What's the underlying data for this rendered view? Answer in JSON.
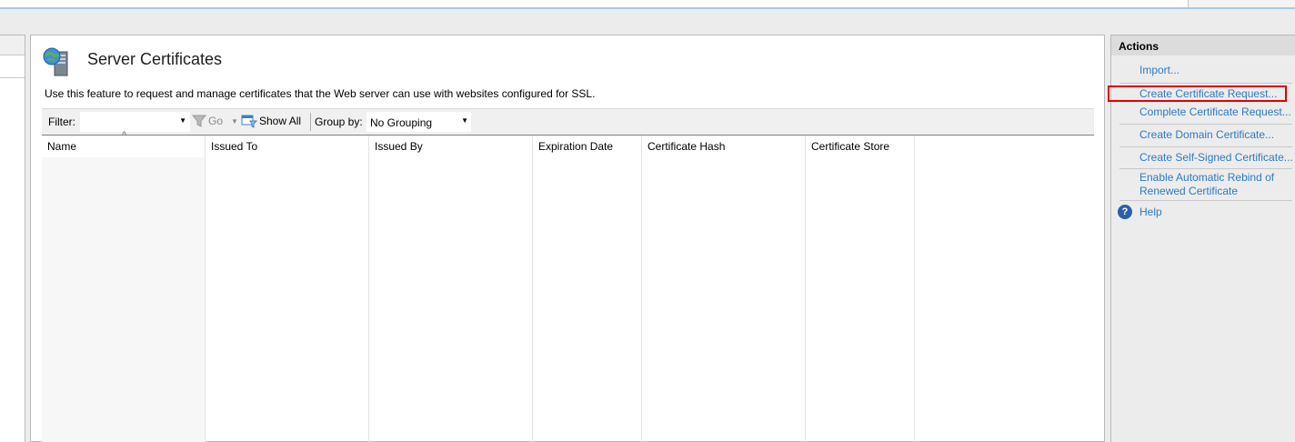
{
  "page": {
    "title": "Server Certificates",
    "description": "Use this feature to request and manage certificates that the Web server can use with websites configured for SSL."
  },
  "filterbar": {
    "filter_label": "Filter:",
    "filter_value": "",
    "go_label": "Go",
    "show_all_label": "Show All",
    "group_by_label": "Group by:",
    "group_by_value": "No Grouping"
  },
  "table": {
    "columns": [
      "Name",
      "Issued To",
      "Issued By",
      "Expiration Date",
      "Certificate Hash",
      "Certificate Store"
    ],
    "sorted_column": "Name",
    "rows": []
  },
  "actions": {
    "title": "Actions",
    "items": [
      {
        "label": "Import..."
      },
      {
        "label": "Create Certificate Request..."
      },
      {
        "label": "Complete Certificate Request..."
      },
      {
        "label": "Create Domain Certificate..."
      },
      {
        "label": "Create Self-Signed Certificate..."
      },
      {
        "label": "Enable Automatic Rebind of"
      },
      {
        "label": "Renewed Certificate"
      },
      {
        "label": "Help"
      }
    ],
    "highlighted": "Create Certificate Request..."
  },
  "colors": {
    "link": "#2d7ac2",
    "highlight_box": "#e00000",
    "panel_bg": "#ececec"
  },
  "icons": {
    "feature": "server-certificate-icon",
    "go": "funnel-icon",
    "show_all": "show-all-icon",
    "help": "help-icon"
  }
}
